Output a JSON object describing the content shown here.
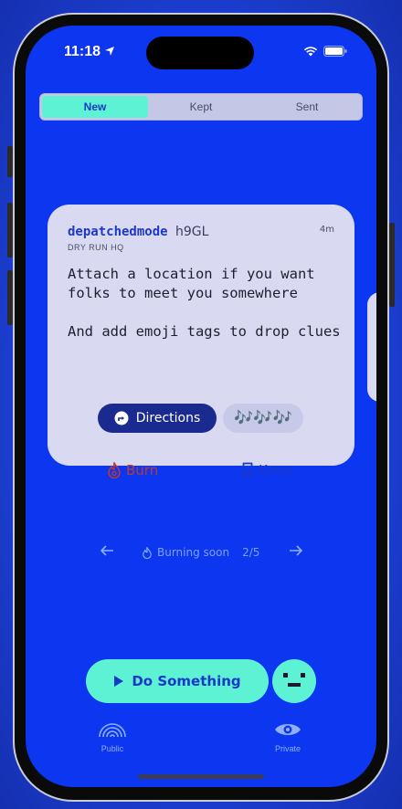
{
  "status_bar": {
    "time": "11:18"
  },
  "segments": [
    {
      "label": "New",
      "active": true
    },
    {
      "label": "Kept",
      "active": false
    },
    {
      "label": "Sent",
      "active": false
    }
  ],
  "card": {
    "author": "depatchedmode",
    "author_code": "h9GL",
    "place": "DRY RUN HQ",
    "age": "4m",
    "message": "Attach a location if you want folks to meet you somewhere\n\nAnd add emoji tags to drop clues",
    "directions_label": "Directions",
    "tags": "🎶🎶🎶",
    "burn_label": "Burn",
    "keep_label": "Keep"
  },
  "pager": {
    "status": "Burning soon",
    "position": "2/5"
  },
  "cta_label": "Do Something",
  "tabs": [
    {
      "label": "Public",
      "icon": "rainbow-icon"
    },
    {
      "label": "Private",
      "icon": "eye-icon"
    }
  ],
  "colors": {
    "background": "#0c36f0",
    "accent": "#5ef2d4",
    "card": "#d9daf2",
    "burn": "#c0392b"
  }
}
